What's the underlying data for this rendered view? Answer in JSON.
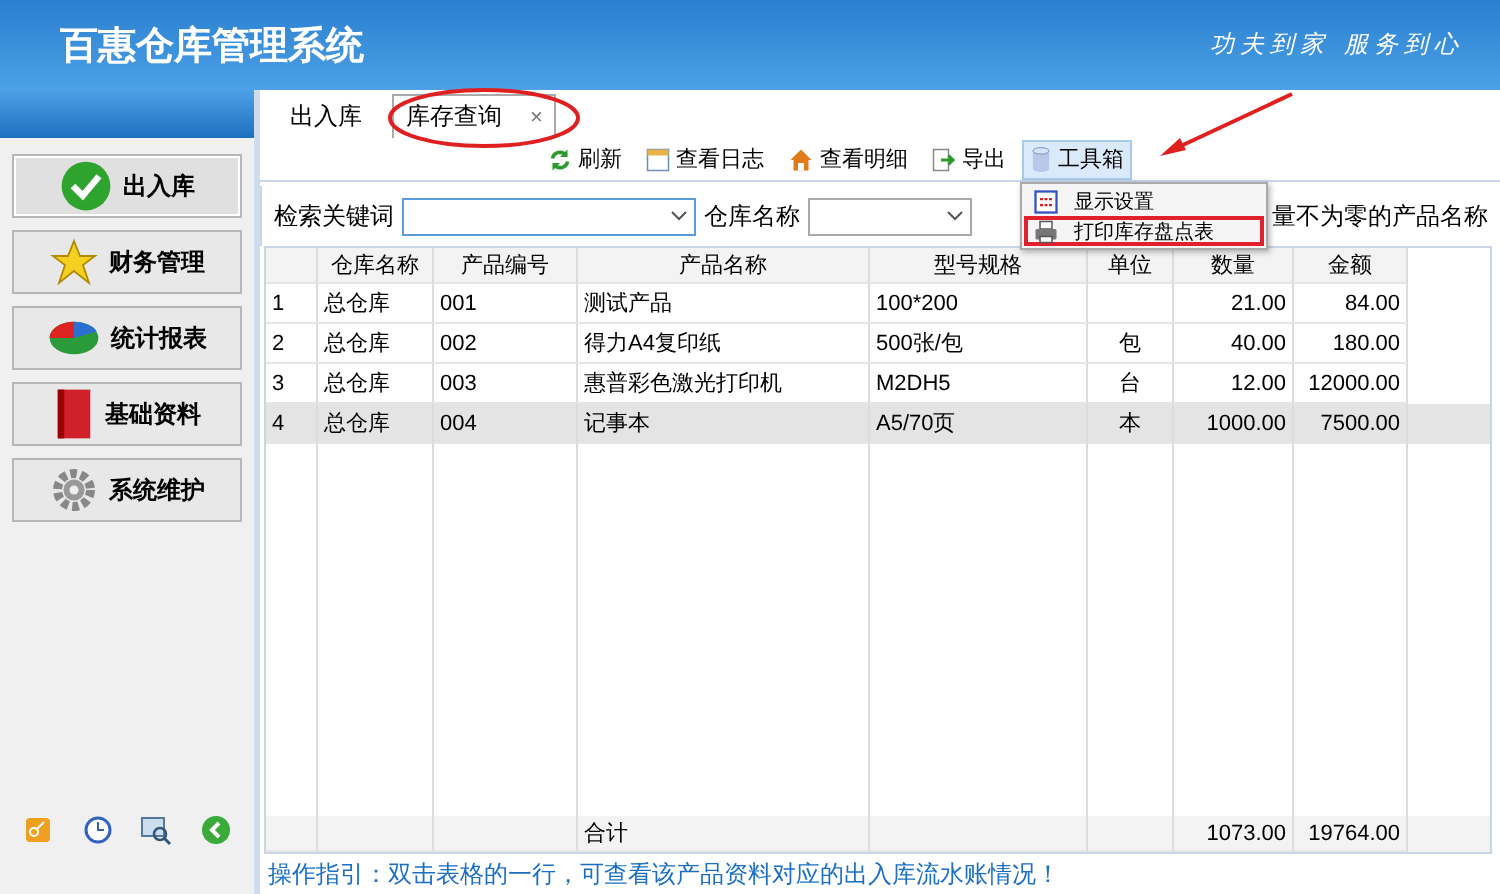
{
  "header": {
    "title": "百惠仓库管理系统",
    "slogan": "功夫到家 服务到心"
  },
  "sidebar": {
    "items": [
      {
        "label": "出入库",
        "selected": true
      },
      {
        "label": "财务管理",
        "selected": false
      },
      {
        "label": "统计报表",
        "selected": false
      },
      {
        "label": "基础资料",
        "selected": false
      },
      {
        "label": "系统维护",
        "selected": false
      }
    ]
  },
  "tabs": [
    {
      "label": "出入库",
      "selected": false
    },
    {
      "label": "库存查询",
      "selected": true,
      "close": "×"
    }
  ],
  "toolbar": [
    {
      "label": "刷新",
      "active": false
    },
    {
      "label": "查看日志",
      "active": false
    },
    {
      "label": "查看明细",
      "active": false
    },
    {
      "label": "导出",
      "active": false
    },
    {
      "label": "工具箱",
      "active": true
    }
  ],
  "menu": {
    "items": [
      {
        "label": "显示设置",
        "highlighted": false
      },
      {
        "label": "打印库存盘点表",
        "highlighted": true
      }
    ]
  },
  "filters": {
    "keyword_label": "检索关键词",
    "warehouse_label": "仓库名称",
    "nonzero_label": "量不为零的产品名称"
  },
  "table": {
    "columns": [
      "仓库名称",
      "产品编号",
      "产品名称",
      "型号规格",
      "单位",
      "数量",
      "金额"
    ],
    "rows": [
      {
        "index": "1",
        "cells": [
          "总仓库",
          "001",
          "测试产品",
          "100*200",
          "",
          "21.00",
          "84.00"
        ],
        "selected": false
      },
      {
        "index": "2",
        "cells": [
          "总仓库",
          "002",
          "得力A4复印纸",
          "500张/包",
          "包",
          "40.00",
          "180.00"
        ],
        "selected": false
      },
      {
        "index": "3",
        "cells": [
          "总仓库",
          "003",
          "惠普彩色激光打印机",
          "M2DH5",
          "台",
          "12.00",
          "12000.00"
        ],
        "selected": false
      },
      {
        "index": "4",
        "cells": [
          "总仓库",
          "004",
          "记事本",
          "A5/70页",
          "本",
          "1000.00",
          "7500.00"
        ],
        "selected": true
      }
    ],
    "total": {
      "label": "合计",
      "quantity": "1073.00",
      "amount": "19764.00"
    }
  },
  "status_bar": "操作指引：双击表格的一行，可查看该产品资料对应的出入库流水账情况！"
}
